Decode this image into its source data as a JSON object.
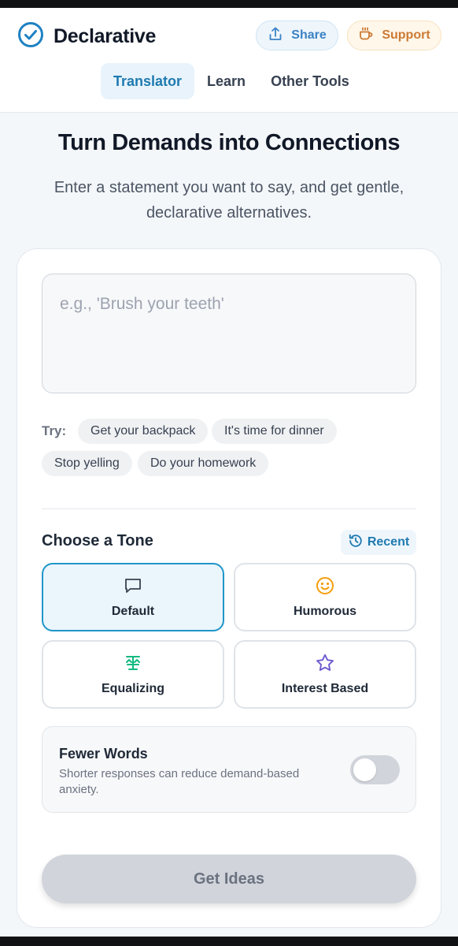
{
  "app": {
    "title": "Declarative"
  },
  "header": {
    "share_label": "Share",
    "support_label": "Support"
  },
  "tabs": [
    {
      "label": "Translator",
      "active": true
    },
    {
      "label": "Learn",
      "active": false
    },
    {
      "label": "Other Tools",
      "active": false
    }
  ],
  "hero": {
    "title": "Turn Demands into Connections",
    "subtitle": "Enter a statement you want to say, and get gentle, declarative alternatives."
  },
  "input": {
    "value": "",
    "placeholder": "e.g., 'Brush your teeth'"
  },
  "suggestions": {
    "label": "Try:",
    "items": [
      "Get your backpack",
      "It's time for dinner",
      "Stop yelling",
      "Do your homework"
    ]
  },
  "tone": {
    "heading": "Choose a Tone",
    "recent_label": "Recent",
    "selected": "Default",
    "options": [
      {
        "label": "Default",
        "icon": "message-square-icon",
        "color": "#374151"
      },
      {
        "label": "Humorous",
        "icon": "smile-icon",
        "color": "#f59e0b"
      },
      {
        "label": "Equalizing",
        "icon": "balance-icon",
        "color": "#10b981"
      },
      {
        "label": "Interest Based",
        "icon": "star-icon",
        "color": "#6d5bd0"
      }
    ]
  },
  "fewer_words": {
    "title": "Fewer Words",
    "description": "Shorter responses can reduce demand-based anxiety.",
    "enabled": false
  },
  "submit": {
    "label": "Get Ideas",
    "enabled": false
  },
  "colors": {
    "accent": "#1f96c9",
    "tab_active_text": "#1e7ab0",
    "share_text": "#3b82c4",
    "support_text": "#cc7a33"
  }
}
